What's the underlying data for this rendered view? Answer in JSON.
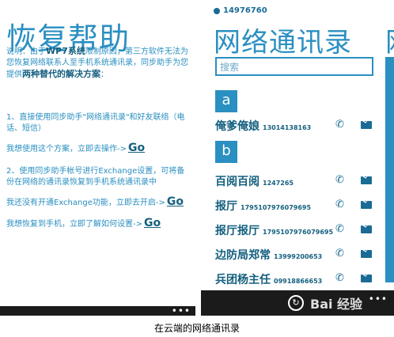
{
  "left": {
    "title": "恢复帮助",
    "intro_1": "说明：由于",
    "intro_wp7": "WP7系统",
    "intro_2": "限制原因，第三方软件无法为您恢复网络联系人至手机系统通讯录，同步助手为您提供",
    "intro_bold": "两种替代的解决方案",
    "intro_3": "：",
    "option1": "1、直接使用同步助手\"网络通讯录\"和好友联络（电话、短信）",
    "option1_action": "我想使用这个方案，立即去操作->",
    "option2": "2、使用同步助手帐号进行Exchange设置，可将备份在网络的通讯录恢复到手机系统通讯录中",
    "option2_action": "我还没有开通Exchange功能，立即去开启->",
    "option3_action": "我想恢复到手机，立即了解如何设置->",
    "go": "Go"
  },
  "right": {
    "account": "14976760",
    "title": "网络通讯录",
    "title_partial": "网",
    "search_placeholder": "搜索",
    "groups": [
      {
        "letter": "a"
      },
      {
        "letter": "b"
      }
    ],
    "contacts": [
      {
        "name": "俺爹俺娘",
        "number": "13014138163"
      },
      {
        "name": "百阅百阅",
        "number": "1247265"
      },
      {
        "name": "报厅",
        "number": "1795107976079695"
      },
      {
        "name": "报厅报厅",
        "number": "1795107976079695"
      },
      {
        "name": "边防局郑常",
        "number": "13999200653"
      },
      {
        "name": "兵团杨主任",
        "number": "09918866653"
      }
    ],
    "watermark": "Bai 经验"
  },
  "caption": "在云端的网络通讯录",
  "colors": {
    "accent": "#2a8fc1",
    "dark_text": "#14607f",
    "app_bar": "#1b1b1b"
  },
  "icons": {
    "call": "phone-icon",
    "mail": "mail-icon",
    "refresh": "refresh-icon",
    "more": "more-dots-icon",
    "account": "account-dot-icon"
  }
}
